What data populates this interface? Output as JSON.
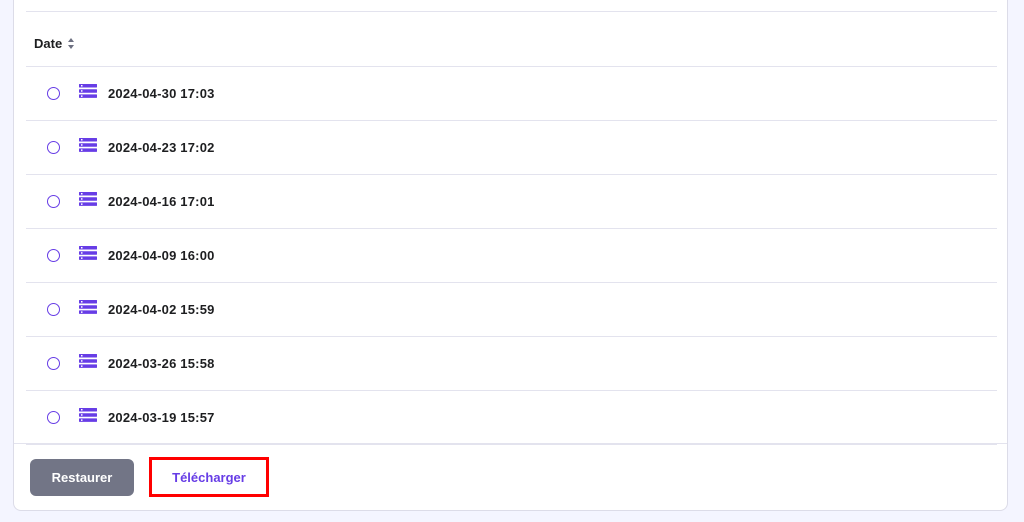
{
  "table": {
    "date_header": "Date",
    "sort_icon": "sort-icon"
  },
  "backups": [
    {
      "date": "2024-04-30 17:03",
      "selected": false,
      "icon": "database-icon"
    },
    {
      "date": "2024-04-23 17:02",
      "selected": false,
      "icon": "database-icon"
    },
    {
      "date": "2024-04-16 17:01",
      "selected": false,
      "icon": "database-icon"
    },
    {
      "date": "2024-04-09 16:00",
      "selected": false,
      "icon": "database-icon"
    },
    {
      "date": "2024-04-02 15:59",
      "selected": false,
      "icon": "database-icon"
    },
    {
      "date": "2024-03-26 15:58",
      "selected": false,
      "icon": "database-icon"
    },
    {
      "date": "2024-03-19 15:57",
      "selected": false,
      "icon": "database-icon"
    }
  ],
  "actions": {
    "restore_label": "Restaurer",
    "download_label": "Télécharger"
  },
  "colors": {
    "accent": "#673de6",
    "restore_bg": "#727586",
    "highlight": "#ff0000",
    "text": "#1d1e20"
  }
}
